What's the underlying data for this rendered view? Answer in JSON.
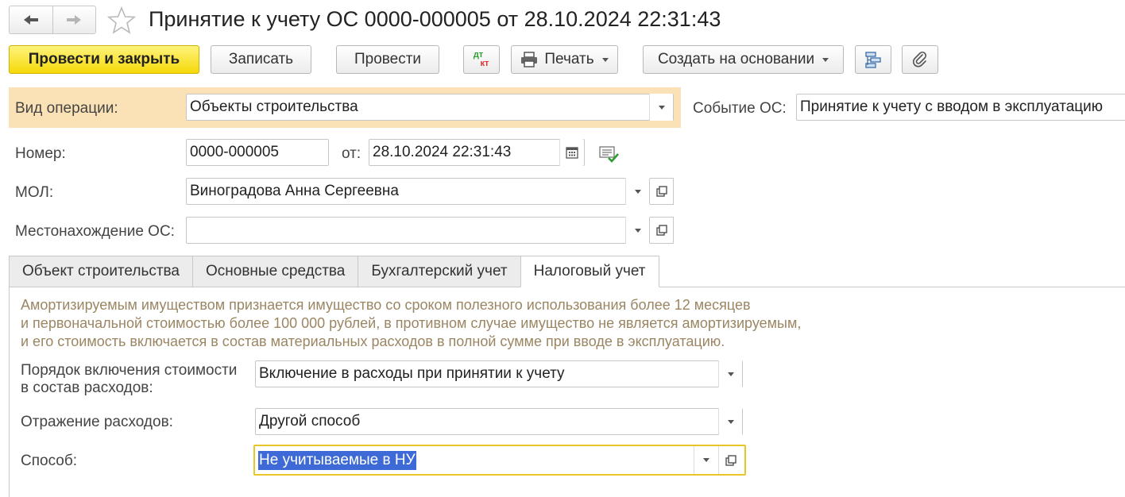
{
  "window": {
    "title": "Принятие к учету ОС 0000-000005 от 28.10.2024 22:31:43"
  },
  "icons": {
    "back": "arrow-left-icon",
    "forward": "arrow-right-icon",
    "favorite": "star-icon",
    "dtkt": "debit-credit-icon",
    "print": "printer-icon",
    "structure": "structure-icon",
    "attach": "paperclip-icon",
    "calendar": "calendar-icon",
    "posted": "posted-document-icon"
  },
  "toolbar": {
    "post_close": "Провести и закрыть",
    "save": "Записать",
    "post": "Провести",
    "dtkt_top": "дт",
    "dtkt_bottom": "кт",
    "print": "Печать",
    "create_based": "Создать на основании"
  },
  "form": {
    "operation_label": "Вид операции:",
    "operation_value": "Объекты строительства",
    "event_label": "Событие ОС:",
    "event_value": "Принятие к учету с вводом в эксплуатацию",
    "number_label": "Номер:",
    "number_value": "0000-000005",
    "date_label": "от:",
    "date_value": "28.10.2024 22:31:43",
    "mol_label": "МОЛ:",
    "mol_value": "Виноградова Анна Сергеевна",
    "location_label": "Местонахождение ОС:",
    "location_value": ""
  },
  "tabs": [
    {
      "label": "Объект строительства",
      "active": false
    },
    {
      "label": "Основные средства",
      "active": false
    },
    {
      "label": "Бухгалтерский учет",
      "active": false
    },
    {
      "label": "Налоговый учет",
      "active": true
    }
  ],
  "tax": {
    "note_lines": [
      "Амортизируемым имуществом признается имущество со сроком полезного использования более 12 месяцев",
      "и первоначальной стоимостью более 100 000 рублей, в противном случае имущество не является амортизируемым,",
      "и его стоимость включается в состав материальных расходов в полной сумме при вводе в эксплуатацию."
    ],
    "order_label_1": "Порядок включения стоимости",
    "order_label_2": "в состав расходов:",
    "order_value": "Включение в расходы при принятии к учету",
    "reflection_label": "Отражение расходов:",
    "reflection_value": "Другой способ",
    "method_label": "Способ:",
    "method_value": "Не учитываемые в НУ"
  },
  "colors": {
    "accent_yellow": "#f5d90a",
    "operation_row_bg": "#fbe2b6",
    "note_text": "#9b8663",
    "selection": "#3d6ad6",
    "focus_border": "#e8c628"
  }
}
